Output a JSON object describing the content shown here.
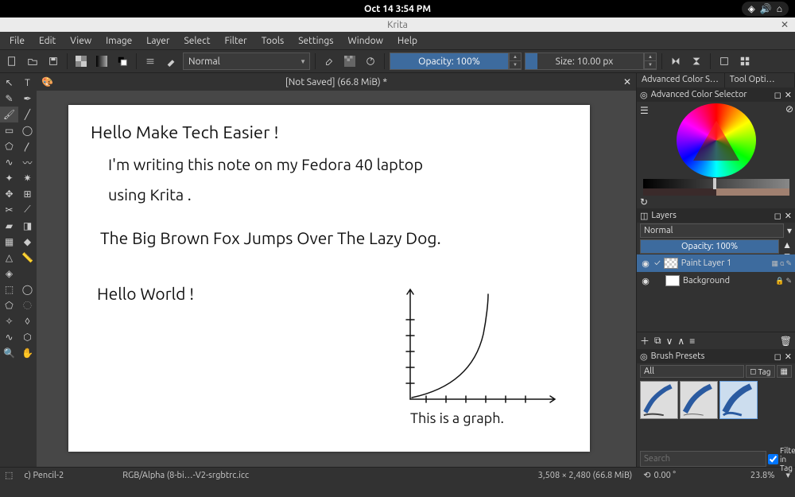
{
  "os": {
    "clock": "Oct 14   3:54 PM"
  },
  "window": {
    "title": "Krita",
    "doc_title": "[Not Saved]  (66.8 MiB) *"
  },
  "menu": [
    "File",
    "Edit",
    "View",
    "Image",
    "Layer",
    "Select",
    "Filter",
    "Tools",
    "Settings",
    "Window",
    "Help"
  ],
  "toolbar": {
    "blend_mode": "Normal",
    "opacity_label": "Opacity: 100%",
    "size_label": "Size: 10.00 px"
  },
  "panels": {
    "acs_tab": "Advanced Color Selec…",
    "tool_tab": "Tool Opti…",
    "acs_title": "Advanced Color Selector",
    "layers_title": "Layers",
    "layers_blend": "Normal",
    "layers_opacity": "Opacity:  100%",
    "layers": [
      {
        "name": "Paint Layer 1",
        "selected": true
      },
      {
        "name": "Background",
        "selected": false
      }
    ],
    "brush_title": "Brush Presets",
    "brush_filter": "All",
    "brush_tag": "Tag",
    "search_placeholder": "Search",
    "filter_tag_label": "Filter in Tag"
  },
  "status": {
    "brush": "c) Pencil-2",
    "colorspace": "RGB/Alpha (8-bi…-V2-srgbtrc.icc",
    "dims": "3,508 × 2,480 (66.8 MiB)",
    "angle": "0.00 °",
    "zoom": "23.8%"
  },
  "canvas_text": {
    "l1": "Hello Make Tech Easier !",
    "l2": "I'm writing this note on my Fedora 40 laptop",
    "l3": "using Krita .",
    "l4": "The Big Brown Fox Jumps Over The Lazy Dog.",
    "l5": "Hello World !",
    "l6": "This is a graph."
  }
}
